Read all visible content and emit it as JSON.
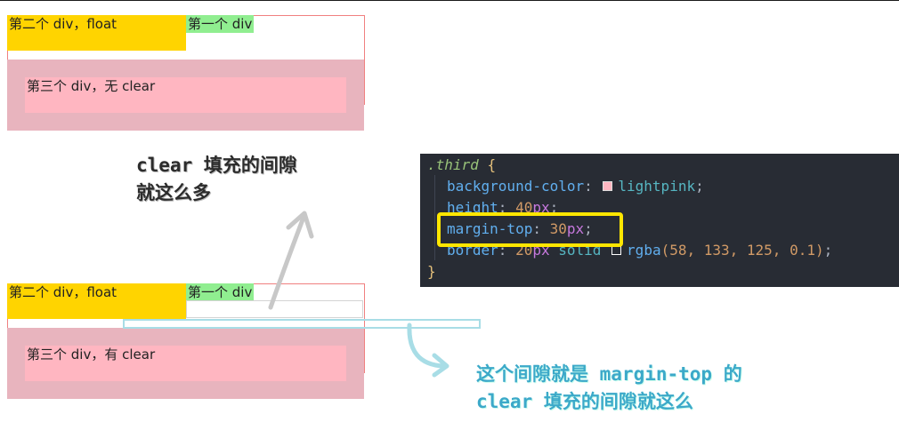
{
  "demo1": {
    "float_div_label": "第二个 div，float",
    "first_div_label": "第一个 div",
    "third_div_label": "第三个 div，无 clear"
  },
  "demo2": {
    "float_div_label": "第二个 div，float",
    "first_div_label": "第一个 div",
    "third_div_label": "第三个 div，有 clear"
  },
  "annotations": {
    "note1_line1": "clear 填充的间隙",
    "note1_line2": "就这么多",
    "note2_line1": "这个间隙就是 margin-top 的",
    "note2_line2": "clear 填充的间隙就这么"
  },
  "code": {
    "selector": ".third",
    "open_brace": "{",
    "close_brace": "}",
    "lines": [
      {
        "prop": "background-color",
        "value": "lightpink"
      },
      {
        "prop": "height",
        "num": "40",
        "unit": "px"
      },
      {
        "prop": "margin-top",
        "num": "30",
        "unit": "px"
      },
      {
        "prop": "border",
        "num": "20",
        "unit": "px",
        "keyword": "solid",
        "fn": "rgba",
        "args": "(58, 133, 125, 0.1)"
      }
    ]
  },
  "colors": {
    "float_yellow": "#ffd400",
    "first_green": "#90ee90",
    "lightpink": "#ffb6c1",
    "highlight": "#ffe600",
    "arrow_grey": "#c8c8c8",
    "arrow_blue": "#a8dde6"
  }
}
